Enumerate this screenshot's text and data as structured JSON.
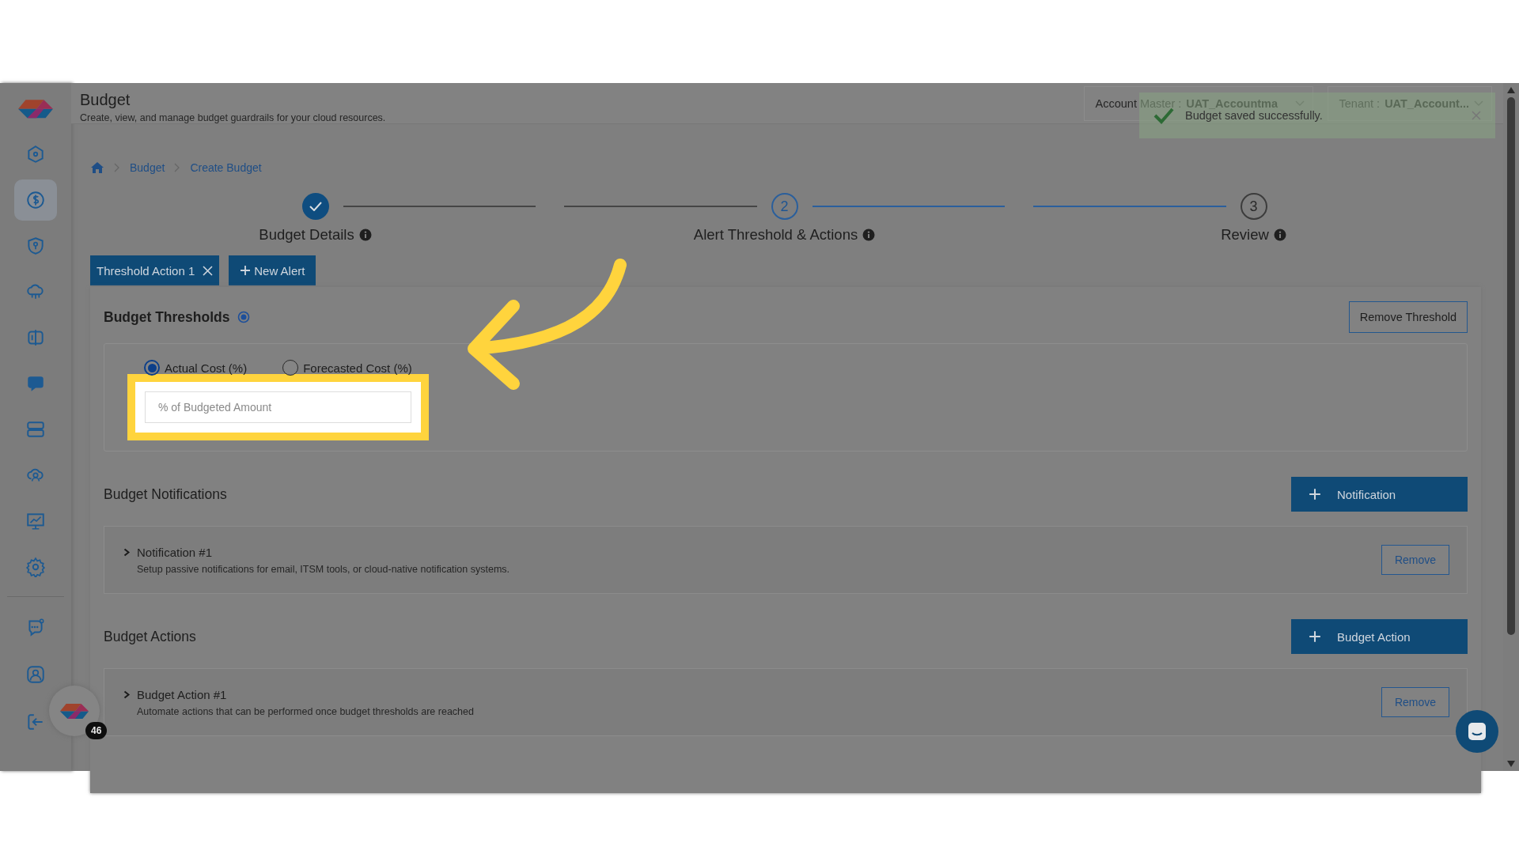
{
  "header": {
    "title": "Budget",
    "subtitle": "Create, view, and manage budget guardrails for your cloud resources.",
    "dropdowns": [
      {
        "label": "Account Master :",
        "value": "UAT_Accountma"
      },
      {
        "label": "Tenant :",
        "value": "UAT_Account..."
      }
    ]
  },
  "toast": {
    "message": "Budget saved successfully."
  },
  "sidebar": {
    "items": [
      {
        "selected": false
      },
      {
        "selected": true
      },
      {
        "selected": false
      },
      {
        "selected": false
      },
      {
        "selected": false
      },
      {
        "selected": false
      },
      {
        "selected": false
      },
      {
        "selected": false
      },
      {
        "selected": false
      },
      {
        "selected": false
      }
    ],
    "bottom_items": [
      {
        "selected": false
      },
      {
        "selected": false
      },
      {
        "selected": false
      }
    ]
  },
  "floating_badge": {
    "count": "46"
  },
  "breadcrumb": [
    "Budget",
    "Create Budget"
  ],
  "steps": [
    {
      "label": "Budget Details",
      "completed": true,
      "selected": false
    },
    {
      "number": "2",
      "label": "Alert Threshold & Actions",
      "completed": false,
      "selected": true
    },
    {
      "number": "3",
      "label": "Review",
      "completed": false,
      "selected": false
    }
  ],
  "tabs": [
    {
      "label": "Threshold Action 1",
      "selected": true
    }
  ],
  "new_alert_button": "New Alert",
  "thresholds": {
    "title": "Budget Thresholds",
    "remove_button": "Remove Threshold",
    "options": [
      {
        "label": "Actual Cost (%)",
        "selected": true
      },
      {
        "label": "Forecasted Cost (%)",
        "selected": false
      }
    ],
    "input": {
      "placeholder": "% of Budgeted Amount"
    }
  },
  "sections": [
    {
      "title": "Budget Notifications",
      "add_button": "Notification",
      "items": [
        {
          "title": "Notification #1",
          "description": "Setup passive notifications for email, ITSM tools, or cloud-native notification systems.",
          "remove": "Remove",
          "expanded": false
        }
      ]
    },
    {
      "title": "Budget Actions",
      "add_button": "Budget Action",
      "items": [
        {
          "title": "Budget Action #1",
          "description": "Automate actions that can be performed once budget thresholds are reached",
          "remove": "Remove",
          "expanded": false
        }
      ]
    }
  ]
}
